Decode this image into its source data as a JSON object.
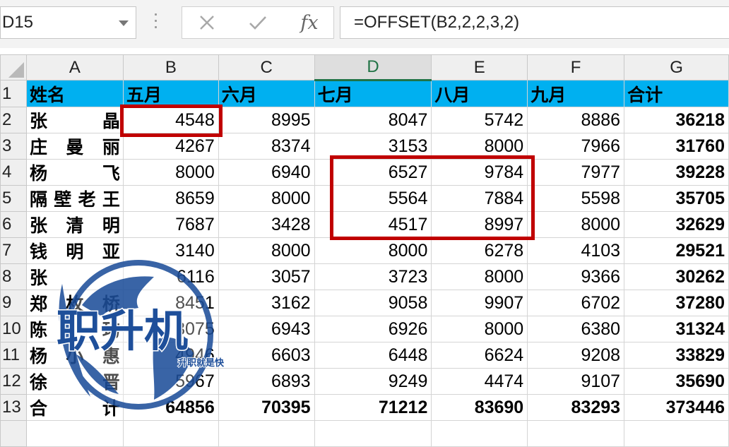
{
  "formula_bar": {
    "name_box": "D15",
    "cancel_icon": "close-icon",
    "enter_icon": "check-icon",
    "fx_label": "fx",
    "formula": "=OFFSET(B2,2,2,3,2)"
  },
  "columns": [
    "A",
    "B",
    "C",
    "D",
    "E",
    "F",
    "G"
  ],
  "selected_column": "D",
  "header_row": [
    "姓名",
    "五月",
    "六月",
    "七月",
    "八月",
    "九月",
    "合计"
  ],
  "rows": [
    {
      "num": "2",
      "name": "张晶",
      "values": [
        "4548",
        "8995",
        "8047",
        "5742",
        "8886",
        "36218"
      ]
    },
    {
      "num": "3",
      "name": "庄曼丽",
      "values": [
        "4267",
        "8374",
        "3153",
        "8000",
        "7966",
        "31760"
      ]
    },
    {
      "num": "4",
      "name": "杨飞",
      "values": [
        "8000",
        "6940",
        "6527",
        "9784",
        "7977",
        "39228"
      ]
    },
    {
      "num": "5",
      "name": "隔壁老王",
      "values": [
        "8659",
        "8000",
        "5564",
        "7884",
        "5598",
        "35705"
      ]
    },
    {
      "num": "6",
      "name": "张清明",
      "values": [
        "7687",
        "3428",
        "4517",
        "8997",
        "8000",
        "32629"
      ]
    },
    {
      "num": "7",
      "name": "钱明亚",
      "values": [
        "3140",
        "8000",
        "8000",
        "6278",
        "4103",
        "29521"
      ]
    },
    {
      "num": "8",
      "name": "张",
      "values": [
        "6116",
        "3057",
        "3723",
        "8000",
        "9366",
        "30262"
      ]
    },
    {
      "num": "9",
      "name": "郑枚桥",
      "values": [
        "8451",
        "3162",
        "9058",
        "9907",
        "6702",
        "37280"
      ]
    },
    {
      "num": "10",
      "name": "陈玙",
      "values": [
        "3075",
        "6943",
        "6926",
        "8000",
        "6380",
        "31324"
      ]
    },
    {
      "num": "11",
      "name": "杨小惠",
      "values": [
        "4946",
        "6603",
        "6448",
        "6624",
        "9208",
        "33829"
      ]
    },
    {
      "num": "12",
      "name": "徐晋",
      "values": [
        "5967",
        "6893",
        "9249",
        "4474",
        "9107",
        "35690"
      ]
    },
    {
      "num": "13",
      "name": "合计",
      "values": [
        "64856",
        "70395",
        "71212",
        "83690",
        "83293",
        "373446"
      ]
    }
  ],
  "watermark": {
    "title": "职升机",
    "slogan": "升职就是快"
  },
  "colors": {
    "header_fill": "#00b0f0",
    "highlight_border": "#c00000",
    "selected_column_accent": "#217346"
  }
}
